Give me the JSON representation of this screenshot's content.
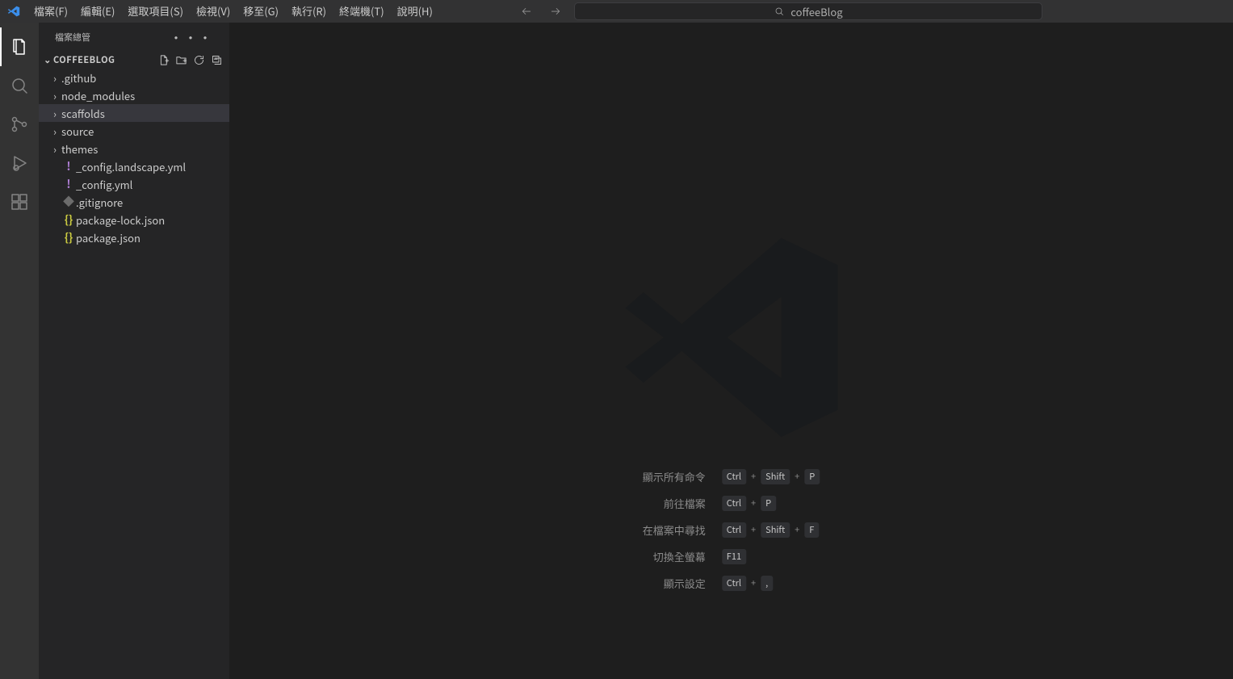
{
  "menus": {
    "file": "檔案(F)",
    "edit": "編輯(E)",
    "selection": "選取項目(S)",
    "view": "檢視(V)",
    "go": "移至(G)",
    "run": "執行(R)",
    "terminal": "終端機(T)",
    "help": "說明(H)"
  },
  "search_text": "coffeeBlog",
  "side_title": "檔案總管",
  "project": "COFFEEBLOG",
  "tree": {
    "github": ".github",
    "node_modules": "node_modules",
    "scaffolds": "scaffolds",
    "source": "source",
    "themes": "themes",
    "cfg_land": "_config.landscape.yml",
    "cfg": "_config.yml",
    "gitignore": ".gitignore",
    "pkg_lock": "package-lock.json",
    "pkg": "package.json"
  },
  "hint_labels": {
    "all_cmd": "顯示所有命令",
    "go_file": "前往檔案",
    "find_in": "在檔案中尋找",
    "fullscreen": "切換全螢幕",
    "settings": "顯示設定"
  },
  "keys": {
    "ctrl": "Ctrl",
    "shift": "Shift",
    "p": "P",
    "f": "F",
    "f11": "F11",
    "comma": ","
  }
}
